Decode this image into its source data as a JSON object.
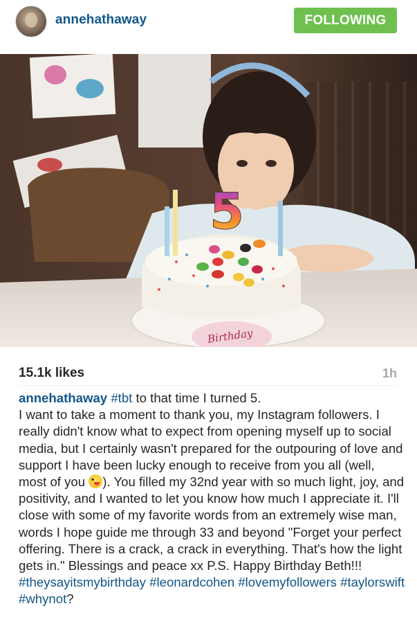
{
  "header": {
    "username": "annehathaway",
    "follow_label": "FOLLOWING",
    "avatar_icon": "profile-avatar"
  },
  "photo": {
    "cake_text": "Birthday",
    "candle_number": "5"
  },
  "meta": {
    "likes": "15.1k likes",
    "time": "1h"
  },
  "caption": {
    "user": "annehathaway",
    "tag_tbt": "#tbt",
    "text1": " to that time I turned 5.",
    "text2": "I want to take a moment to thank you, my Instagram followers. I really didn't know what to expect from opening myself up to social media, but I certainly wasn't prepared for the outpouring of love and support I have been lucky enough to receive from you all (well, most of you ",
    "emoji": "winking-tongue-emoji",
    "text3": "). You filled my 32nd year with so much light, joy, and positivity, and I wanted to let you know how much I appreciate it. I'll close with some of my favorite words from an extremely wise man, words I hope guide me through 33 and beyond \"Forget your perfect offering. There is a crack, a crack in everything. That's how the light gets in.\" Blessings and peace xx P.S. Happy Birthday Beth!!! ",
    "tag1": "#theysayitsmybirthday",
    "tag2": "#leonardcohen",
    "tag3": "#lovemyfollowers",
    "tag4": "#taylorswift",
    "tag5": "#whynot",
    "end": "?"
  },
  "colors": {
    "link": "#125688",
    "follow_button": "#70c050",
    "time": "#a5a7aa"
  }
}
